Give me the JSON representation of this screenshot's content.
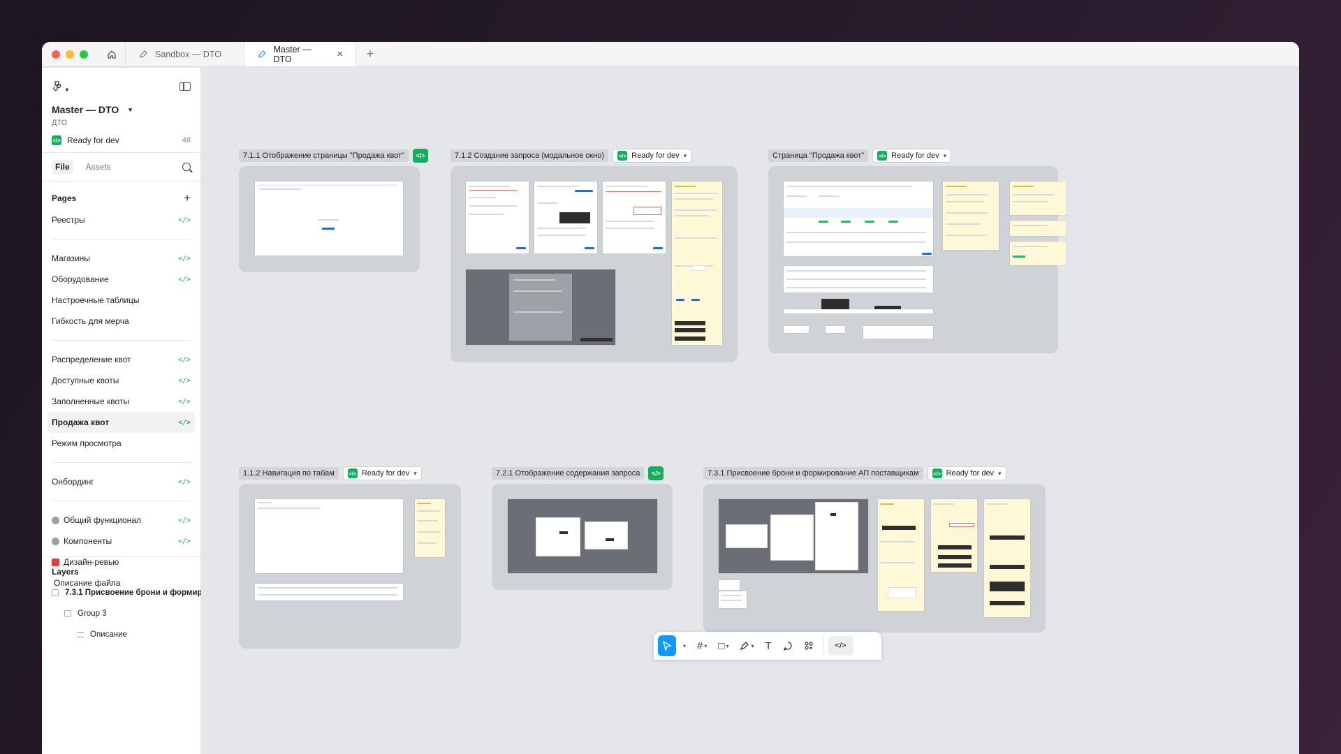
{
  "tabs": {
    "inactive": "Sandbox — DTO",
    "active": "Master — DTO"
  },
  "sidebar": {
    "file_title": "Master — DTO",
    "file_subtitle": "ДТО",
    "ready_for_dev": "Ready for dev",
    "ready_count": "48",
    "file_tab": "File",
    "assets_tab": "Assets",
    "pages_heading": "Pages",
    "pages": [
      {
        "label": "Реестры",
        "dev": true
      },
      {
        "label": "Магазины",
        "dev": true
      },
      {
        "label": "Оборудование",
        "dev": true
      },
      {
        "label": "Настроечные таблицы",
        "dev": false
      },
      {
        "label": "Гибкость для мерча",
        "dev": false
      },
      {
        "label": "Распределение квот",
        "dev": true
      },
      {
        "label": "Доступные квоты",
        "dev": true
      },
      {
        "label": "Заполненные квоты",
        "dev": true
      },
      {
        "label": "Продажа квот",
        "dev": true
      },
      {
        "label": "Режим просмотра",
        "dev": false
      },
      {
        "label": "Онбординг",
        "dev": true
      },
      {
        "label": "Общий функционал",
        "dev": true
      },
      {
        "label": "Компоненты",
        "dev": true
      },
      {
        "label": "Дизайн-ревью",
        "dev": false
      },
      {
        "label": "Описание файла",
        "dev": false
      }
    ],
    "layers_heading": "Layers",
    "layers": [
      "7.3.1 Присвоение брони и формиров",
      "Group 3",
      "Описание"
    ]
  },
  "canvas": {
    "sections": [
      {
        "title": "7.1.1 Отображение страницы \"Продажа квот\"",
        "status": ""
      },
      {
        "title": "7.1.2 Создание запроса (модальное окно)",
        "status": "Ready for dev"
      },
      {
        "title": "Страница \"Продажа квот\"",
        "status": "Ready for dev"
      },
      {
        "title": "1.1.2 Навигация по табам",
        "status": "Ready for dev"
      },
      {
        "title": "7.2.1 Отображение содержания запроса",
        "status": ""
      },
      {
        "title": "7.3.1 Присвоение брони и формирование АП поставщикам",
        "status": "Ready for dev"
      }
    ]
  },
  "toolbar": {
    "tools": [
      "move-tool",
      "frame-tool",
      "shape-tool",
      "pen-tool",
      "text-tool",
      "comment-tool",
      "actions-tool",
      "dev-mode-toggle"
    ],
    "dev_label": "</>"
  },
  "colors": {
    "accent": "#0d99ff",
    "dev_green": "#14ae5c",
    "canvas_bg": "#e4e6ea",
    "section_bg": "#cfd2d7"
  }
}
